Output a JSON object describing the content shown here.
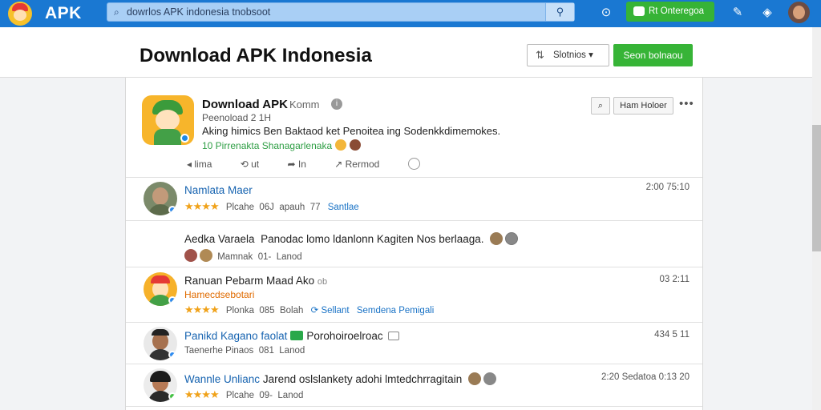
{
  "topbar": {
    "logo_text": "APK",
    "search_value": "dowrlos APK indonesia tnobsoot",
    "green_button_label": "Rt Onteregoa",
    "colors": {
      "bar": "#1a78d2",
      "accent_green": "#36b336"
    }
  },
  "header": {
    "title": "Download APK Indonesia",
    "sort_label": "Slotnios",
    "action_label": "Seon bolnaou"
  },
  "post": {
    "title": "Download APK",
    "title_extra": "Komm",
    "subtitle": "Peenoload 2 1H",
    "description": "Aking himics Ben Baktaod ket Penoitea ing Sodenkkdimemokes.",
    "tags": "10 Pirrenakta Shanagarlenaka",
    "actions": {
      "like": "lima",
      "repost": "ut",
      "share": "In",
      "remind": "Rermod"
    },
    "buttons": {
      "search_icon": "search-icon",
      "filter_label": "Ham Holoer"
    }
  },
  "comments": [
    {
      "name": "Namlata Maer",
      "meta": "Plcahe",
      "count": "06J",
      "extra": "apauh",
      "tail": "77",
      "link": "Santlae",
      "time": "2:00 75:10",
      "stars": "★★★★"
    },
    {
      "name": "Aedka Varaela",
      "text": "Panodac lomo ldanlonn Kagiten  Nos berlaaga.",
      "meta": "Mamnak",
      "count": "01-",
      "extra": "Lanod"
    },
    {
      "name": "Ranuan Pebarm Maad Ako",
      "name_extra": "ob",
      "subtitle": "Hamecdsebotari",
      "meta": "Plonka",
      "count": "085",
      "extra": "Bolah",
      "link": "Sellant",
      "link2": "Semdena Pemigali",
      "time": "03 2:11",
      "stars": "★★★★"
    },
    {
      "name": "Panikd Kagano faolat",
      "text": "Porohoiroelroac",
      "meta": "Taenerhe Pinaos",
      "count": "081",
      "extra": "Lanod",
      "time": "434 5 11"
    },
    {
      "name": "Wannle Unlianc",
      "text": "Jarend oslslankety adohi lmtedchrragitain",
      "meta": "Plcahe",
      "count": "09-",
      "extra": "Lanod",
      "time": "2:20 Sedatoa 0:13 20",
      "stars": "★★★★"
    }
  ]
}
